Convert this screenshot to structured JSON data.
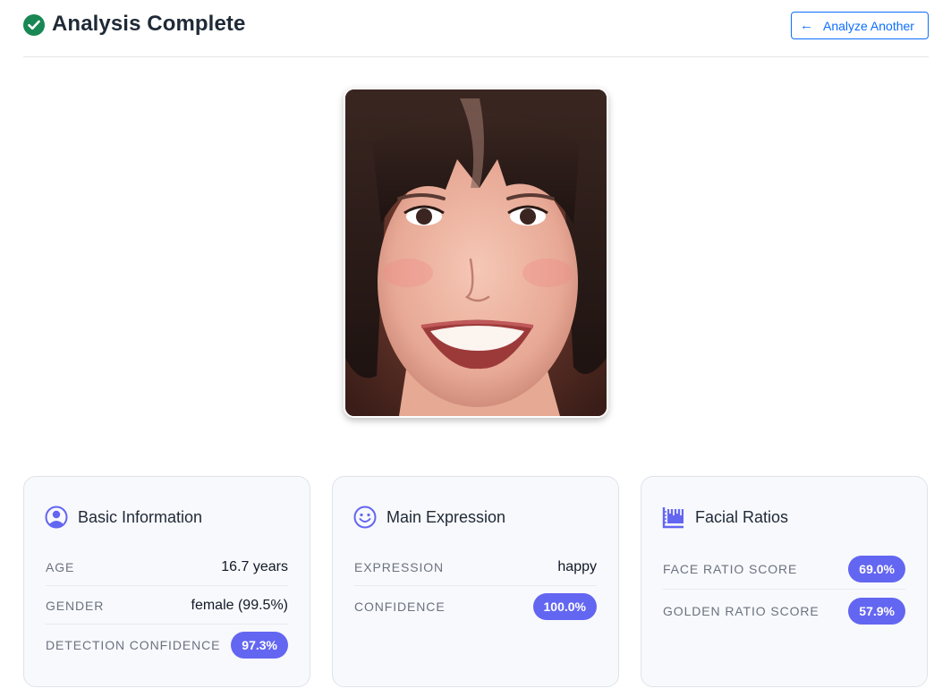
{
  "header": {
    "title": "Analysis Complete",
    "back_arrow": "←",
    "back_label": "Analyze Another"
  },
  "photo": {
    "subject": "face-photo"
  },
  "colors": {
    "success": "#198754",
    "primary": "#0d6efd",
    "badge": "#6366f1"
  },
  "basic_info": {
    "title": "Basic Information",
    "icon": "user-circle-icon",
    "age_label": "AGE",
    "age_value": "16.7 years",
    "gender_label": "GENDER",
    "gender_value": "female (99.5%)",
    "detection_label": "DETECTION CONFIDENCE",
    "detection_value": "97.3%"
  },
  "expression": {
    "title": "Main Expression",
    "icon": "smiley-face-icon",
    "expression_label": "EXPRESSION",
    "expression_value": "happy",
    "confidence_label": "CONFIDENCE",
    "confidence_value": "100.0%"
  },
  "ratios": {
    "title": "Facial Ratios",
    "icon": "ruler-chart-icon",
    "face_label": "FACE RATIO SCORE",
    "face_value": "69.0%",
    "golden_label": "GOLDEN RATIO SCORE",
    "golden_value": "57.9%"
  }
}
